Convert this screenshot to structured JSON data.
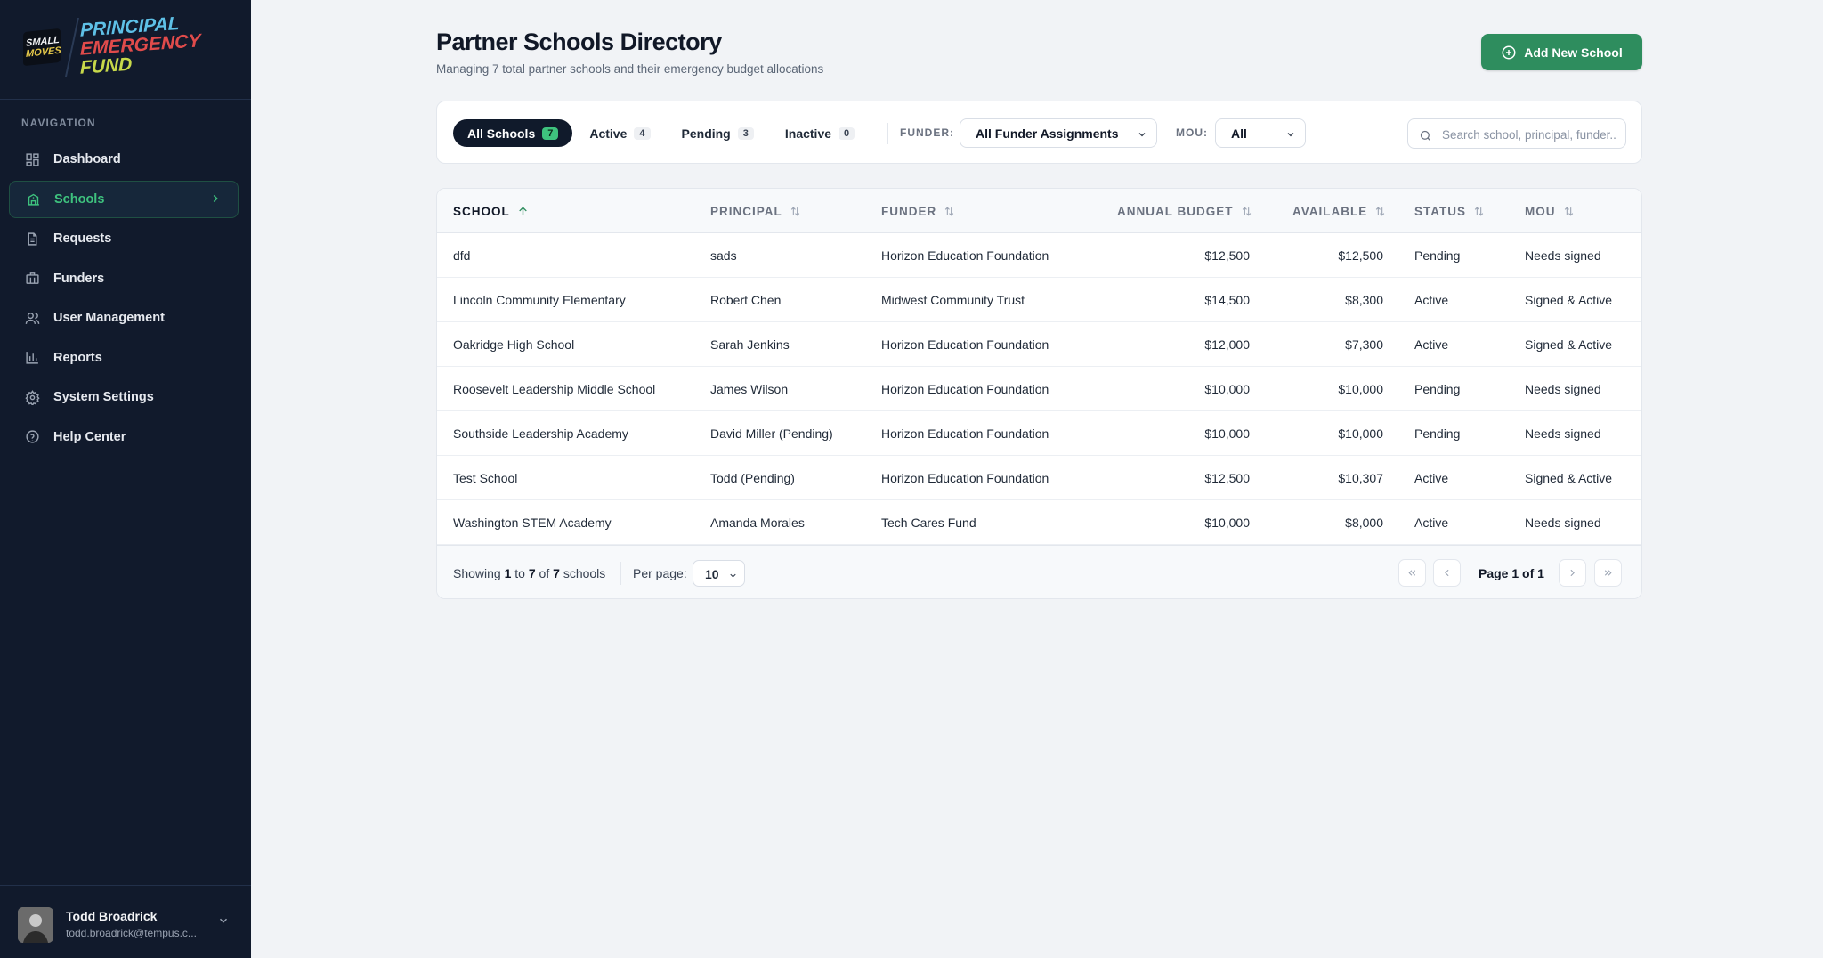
{
  "brand": {
    "small_line1": "SMALL",
    "small_line2": "MOVES",
    "main_line1": "PRINCIPAL",
    "main_line2": "EMERGENCY",
    "main_line3": "FUND"
  },
  "sidebar": {
    "heading": "NAVIGATION",
    "items": [
      {
        "label": "Dashboard",
        "icon": "dashboard-icon"
      },
      {
        "label": "Schools",
        "icon": "school-icon",
        "active": true
      },
      {
        "label": "Requests",
        "icon": "document-icon"
      },
      {
        "label": "Funders",
        "icon": "briefcase-icon"
      },
      {
        "label": "User Management",
        "icon": "users-icon"
      },
      {
        "label": "Reports",
        "icon": "bar-chart-icon"
      },
      {
        "label": "System Settings",
        "icon": "gear-icon"
      },
      {
        "label": "Help Center",
        "icon": "help-icon"
      }
    ]
  },
  "user": {
    "name": "Todd Broadrick",
    "email": "todd.broadrick@tempus.c..."
  },
  "header": {
    "title": "Partner Schools Directory",
    "subtitle": "Managing 7 total partner schools and their emergency budget allocations",
    "add_button": "Add New School"
  },
  "filters": {
    "tabs": [
      {
        "label": "All Schools",
        "count": "7",
        "active": true
      },
      {
        "label": "Active",
        "count": "4"
      },
      {
        "label": "Pending",
        "count": "3"
      },
      {
        "label": "Inactive",
        "count": "0"
      }
    ],
    "funder_label": "FUNDER:",
    "funder_value": "All Funder Assignments",
    "mou_label": "MOU:",
    "mou_value": "All",
    "search_placeholder": "Search school, principal, funder..."
  },
  "table": {
    "columns": [
      "SCHOOL",
      "PRINCIPAL",
      "FUNDER",
      "ANNUAL BUDGET",
      "AVAILABLE",
      "STATUS",
      "MOU"
    ],
    "rows": [
      {
        "school": "dfd",
        "principal": "sads",
        "funder": "Horizon Education Foundation",
        "budget": "$12,500",
        "available": "$12,500",
        "status": "Pending",
        "mou": "Needs signed"
      },
      {
        "school": "Lincoln Community Elementary",
        "principal": "Robert Chen",
        "funder": "Midwest Community Trust",
        "budget": "$14,500",
        "available": "$8,300",
        "status": "Active",
        "mou": "Signed & Active"
      },
      {
        "school": "Oakridge High School",
        "principal": "Sarah Jenkins",
        "funder": "Horizon Education Foundation",
        "budget": "$12,000",
        "available": "$7,300",
        "status": "Active",
        "mou": "Signed & Active"
      },
      {
        "school": "Roosevelt Leadership Middle School",
        "principal": "James Wilson",
        "funder": "Horizon Education Foundation",
        "budget": "$10,000",
        "available": "$10,000",
        "status": "Pending",
        "mou": "Needs signed"
      },
      {
        "school": "Southside Leadership Academy",
        "principal": "David Miller (Pending)",
        "funder": "Horizon Education Foundation",
        "budget": "$10,000",
        "available": "$10,000",
        "status": "Pending",
        "mou": "Needs signed"
      },
      {
        "school": "Test School",
        "principal": "Todd (Pending)",
        "funder": "Horizon Education Foundation",
        "budget": "$12,500",
        "available": "$10,307",
        "status": "Active",
        "mou": "Signed & Active"
      },
      {
        "school": "Washington STEM Academy",
        "principal": "Amanda Morales",
        "funder": "Tech Cares Fund",
        "budget": "$10,000",
        "available": "$8,000",
        "status": "Active",
        "mou": "Needs signed"
      }
    ]
  },
  "footer": {
    "showing_prefix": "Showing",
    "from": "1",
    "to_word": "to",
    "to": "7",
    "of_word": "of",
    "total": "7",
    "suffix": "schools",
    "per_page_label": "Per page:",
    "per_page_value": "10",
    "page_text": "Page 1 of 1"
  },
  "colors": {
    "accent_green": "#2e8d5e",
    "sidebar_bg": "#111a2c",
    "active_nav": "#3ec27e"
  }
}
